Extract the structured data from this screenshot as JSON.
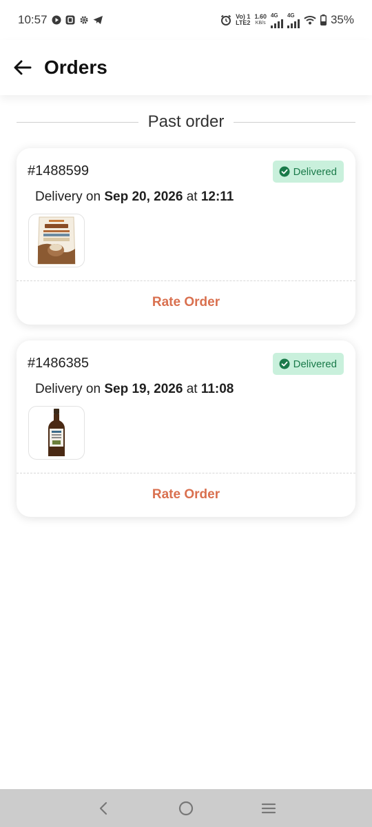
{
  "status_bar": {
    "time": "10:57",
    "left_icons": [
      "youtube-icon",
      "notification-box-icon",
      "settings-icon",
      "telegram-icon"
    ],
    "volte_top": "Vo) 1",
    "volte_bottom": "LTE2",
    "speed_value": "1.60",
    "speed_unit": "KB/s",
    "net1": "4G",
    "net2": "4G",
    "battery": "35%"
  },
  "header": {
    "title": "Orders"
  },
  "section": {
    "label_light": "Past ",
    "label_strong": "order"
  },
  "orders": [
    {
      "id": "#1488599",
      "status": "Delivered",
      "delivery_prefix": "Delivery on ",
      "date": "Sep 20, 2026",
      "at": " at ",
      "time": "12:11",
      "product_image": "protein-mix-pouch",
      "rate_label": "Rate Order"
    },
    {
      "id": "#1486385",
      "status": "Delivered",
      "delivery_prefix": "Delivery on ",
      "date": "Sep 19, 2026",
      "at": " at ",
      "time": "11:08",
      "product_image": "juice-bottle",
      "rate_label": "Rate Order"
    }
  ],
  "colors": {
    "accent": "#d9704f",
    "badge_bg": "#c9f0dc",
    "badge_text": "#1a7a4a",
    "nav_bar": "#cccccc"
  },
  "nav_bar": {
    "icons": [
      "back-triangle-icon",
      "home-circle-icon",
      "recents-menu-icon"
    ]
  }
}
